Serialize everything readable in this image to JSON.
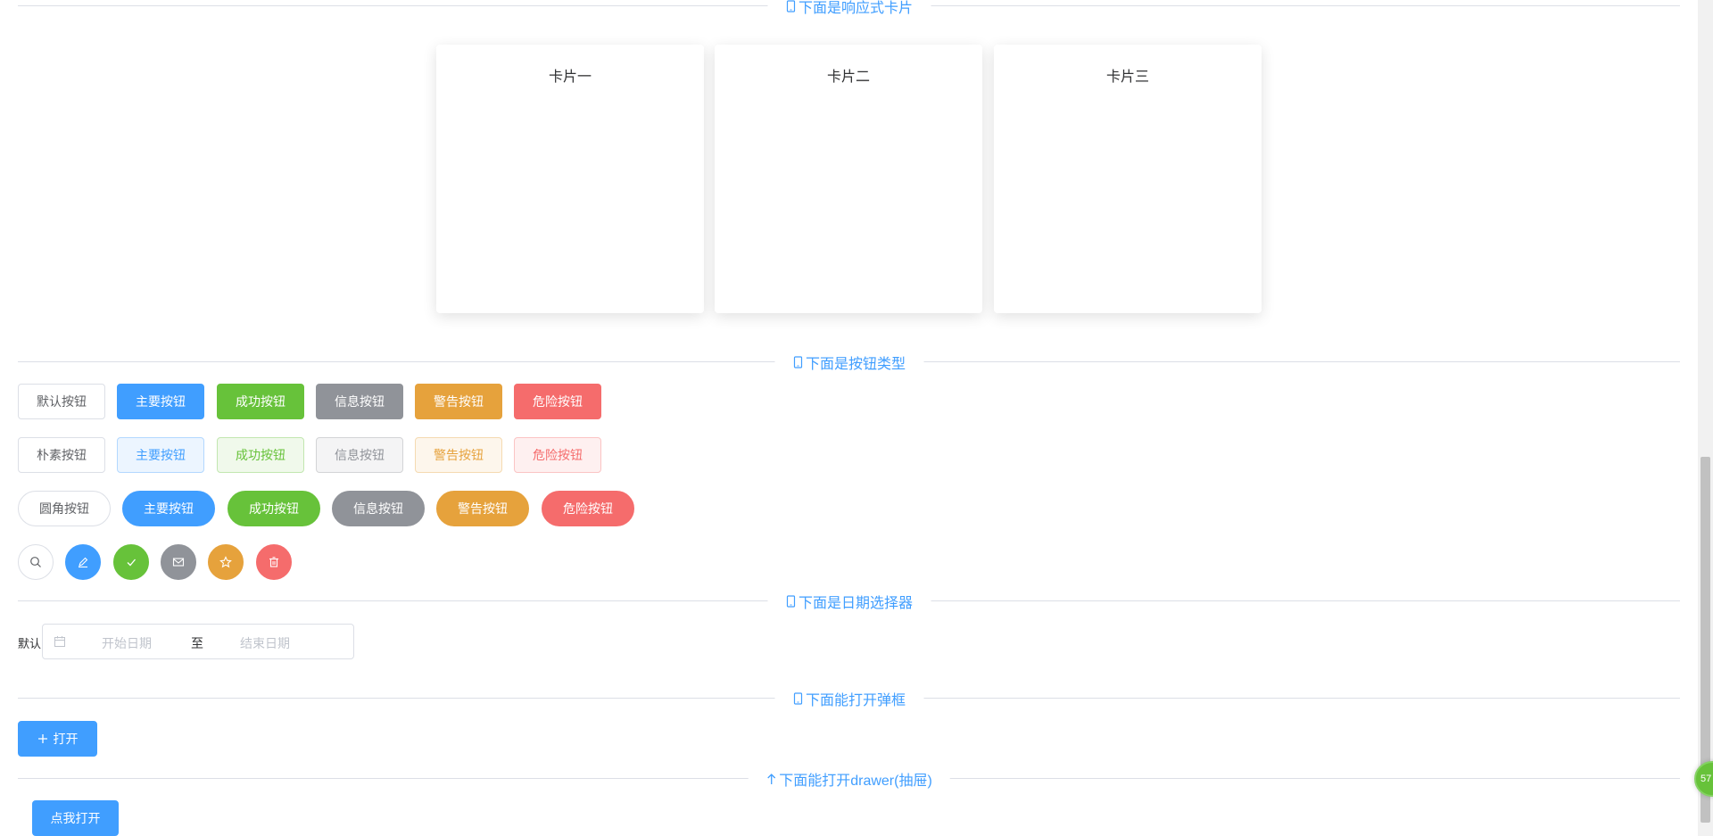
{
  "sections": {
    "cards_title": "下面是响应式卡片",
    "buttons_title": "下面是按钮类型",
    "date_title": "下面是日期选择器",
    "dialog_title": "下面能打开弹框",
    "drawer_title": "下面能打开drawer(抽屉)"
  },
  "cards": [
    "卡片一",
    "卡片二",
    "卡片三"
  ],
  "buttons": {
    "row1": [
      "默认按钮",
      "主要按钮",
      "成功按钮",
      "信息按钮",
      "警告按钮",
      "危险按钮"
    ],
    "row2": [
      "朴素按钮",
      "主要按钮",
      "成功按钮",
      "信息按钮",
      "警告按钮",
      "危险按钮"
    ],
    "row3": [
      "圆角按钮",
      "主要按钮",
      "成功按钮",
      "信息按钮",
      "警告按钮",
      "危险按钮"
    ],
    "icons": [
      "search-icon",
      "edit-icon",
      "check-icon",
      "mail-icon",
      "star-icon",
      "delete-icon"
    ]
  },
  "date_picker": {
    "label": "默认",
    "start_placeholder": "开始日期",
    "separator": "至",
    "end_placeholder": "结束日期"
  },
  "dialog": {
    "open_label": "打开"
  },
  "drawer": {
    "open_label": "点我打开"
  },
  "floater": {
    "text": "57"
  },
  "colors": {
    "primary": "#409eff",
    "success": "#67c23a",
    "info": "#909399",
    "warning": "#e6a23c",
    "danger": "#f56c6c"
  }
}
